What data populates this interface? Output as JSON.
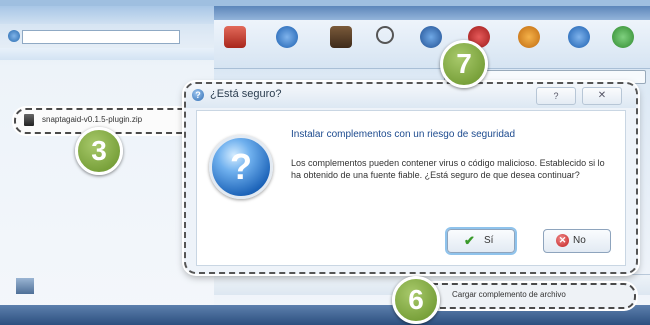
{
  "dialog": {
    "title": "¿Está seguro?",
    "heading": "Instalar complementos con un riesgo de seguridad",
    "message": "Los complementos pueden contener virus o código malicioso. Establecido si lo ha obtenido de una fuente fiable. ¿Está seguro de que desea continuar?",
    "help_icon": "?",
    "close_icon": "✕",
    "question_icon": "?",
    "yes_label": "Sí",
    "no_label": "No"
  },
  "callouts": {
    "file_name": "snaptagaid-v0.1.5-plugin.zip",
    "button_label": "Cargar complemento de archivo",
    "badge_file": "3",
    "badge_button": "6",
    "badge_dialog": "7"
  },
  "colors": {
    "badge": "#7aa23c",
    "dialog_heading": "#1d4b8f",
    "accept": "#3a9a2a",
    "reject": "#c21f1f"
  }
}
